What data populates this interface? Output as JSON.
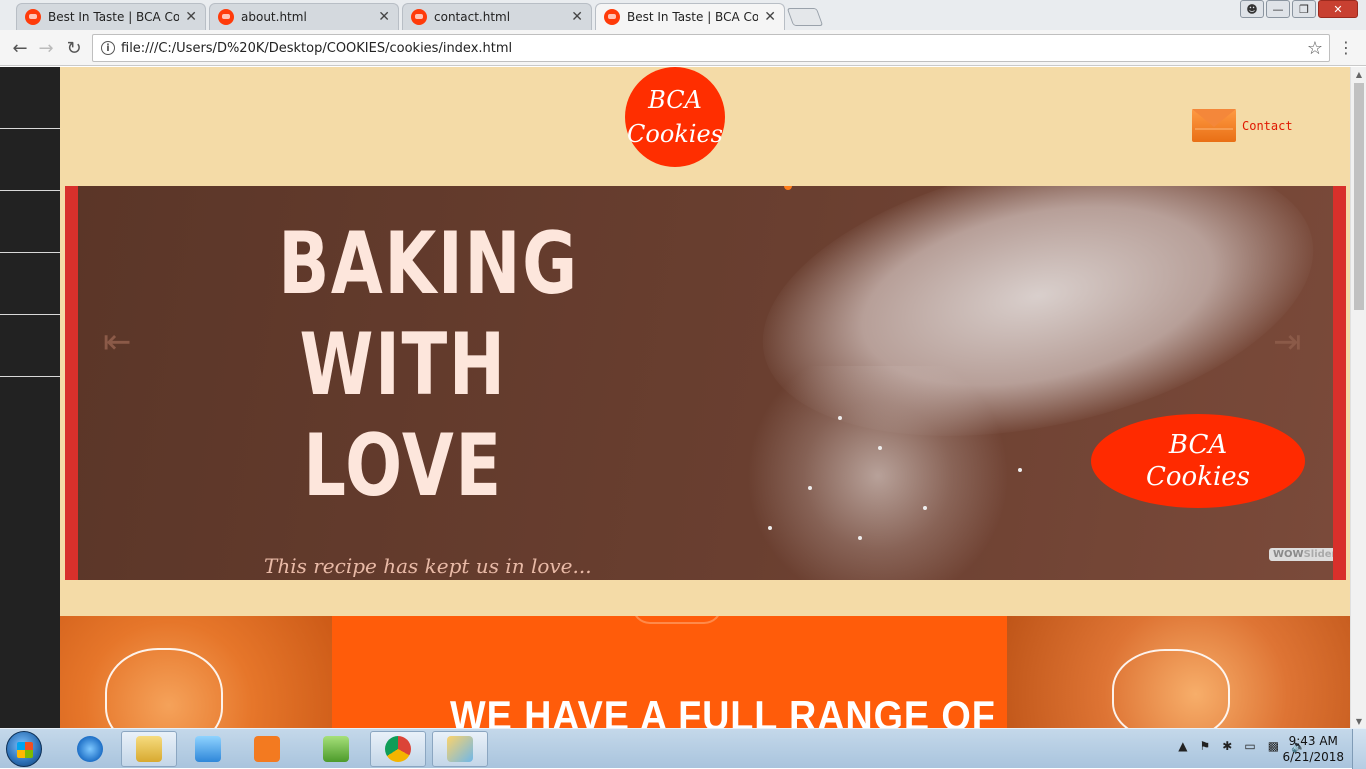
{
  "browser": {
    "tabs": [
      {
        "title": "Best In Taste | BCA Cooki",
        "active": false
      },
      {
        "title": "about.html",
        "active": false
      },
      {
        "title": "contact.html",
        "active": false
      },
      {
        "title": "Best In Taste | BCA Cooki",
        "active": true
      }
    ],
    "url": "file:///C:/Users/D%20K/Desktop/COOKIES/cookies/index.html"
  },
  "site": {
    "logo_line1": "BCA",
    "logo_line2": "Cookies",
    "contact_label": "Contact",
    "slider": {
      "headline_line1": "BAKING",
      "headline_line2": "WITH",
      "headline_line3": "LOVE",
      "tagline": "This recipe has kept us in love...",
      "badge_line1": "BCA",
      "badge_line2": "Cookies",
      "watermark_a": "WOW",
      "watermark_b": "Slider"
    },
    "promo_title": "WE HAVE A FULL RANGE OF"
  },
  "taskbar": {
    "time": "9:43 AM",
    "date": "6/21/2018"
  },
  "colors": {
    "page_bg": "#f4dba7",
    "brand_red": "#ff2e00",
    "promo_orange": "#ff5c0a",
    "sidebar": "#222222"
  }
}
